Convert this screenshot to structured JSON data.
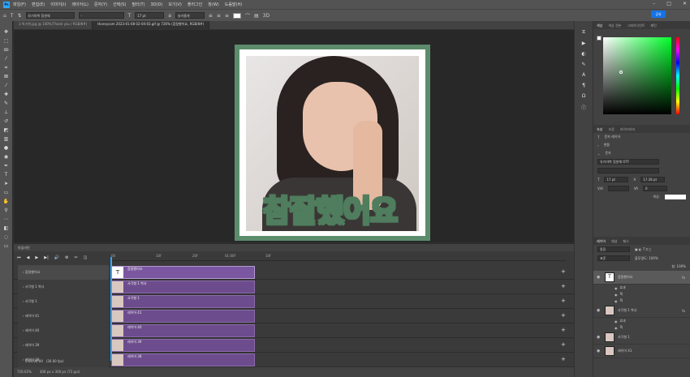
{
  "menu": {
    "logo": "Ps",
    "items": [
      "파일(F)",
      "편집(E)",
      "이미지(I)",
      "레이어(L)",
      "문자(Y)",
      "선택(S)",
      "필터(T)",
      "3D(D)",
      "보기(V)",
      "플러그인",
      "창(W)",
      "도움말(H)"
    ],
    "share": "공유"
  },
  "options": {
    "font_family": "유기야복 힘샌체",
    "font_style": "-",
    "font_size": "17 pt",
    "aa": "날카롭게"
  },
  "tabs": [
    {
      "label": "1-특가위.jpg @ 100%(Thank you / RGB/8#)"
    },
    {
      "label": "Honeycam 2023-01-08 02-04-03.gif @ 726% (참잘했어요, RGB/8#)"
    }
  ],
  "canvas": {
    "caption": "참잘했어요"
  },
  "timeline": {
    "title": "타임라인",
    "ruler": [
      "00",
      "10f",
      "20f",
      "01:00f",
      "10f"
    ],
    "time": "0:00:00:00",
    "fps": "(30.00 fps)",
    "tracks": [
      {
        "label": "참잘했어요",
        "clip": "참잘했어요",
        "text": true
      },
      {
        "label": "사각형 1 복사",
        "clip": "사각형 1 복사",
        "text": false
      },
      {
        "label": "사각형 1",
        "clip": "사각형 1",
        "text": false
      },
      {
        "label": "레이어 41",
        "clip": "레이어 41",
        "text": false
      },
      {
        "label": "레이어 40",
        "clip": "레이어 40",
        "text": false
      },
      {
        "label": "레이어 39",
        "clip": "레이어 39",
        "text": false
      },
      {
        "label": "레이어 38",
        "clip": "레이어 38",
        "text": false
      }
    ]
  },
  "status": {
    "zoom": "726.02%",
    "size": "300 px x 300 px (72 ppi)"
  },
  "color_panel": {
    "tabs": [
      "색상",
      "색상 견본",
      "그레이디언트",
      "패턴"
    ]
  },
  "props_panel": {
    "tabs": [
      "속성",
      "조정",
      "라이브러리"
    ],
    "type": "문자 레이어",
    "section_transform": "변환",
    "section_char": "문자",
    "font": "유기야복 힘샌체 OTF",
    "size": "17 pt",
    "leading": "17.28 pt",
    "tracking": "0",
    "color_label": "색상:"
  },
  "layers_panel": {
    "tabs": [
      "레이어",
      "채널",
      "패스"
    ],
    "filter": "종류",
    "blend": "표준",
    "opacity": "불투명도: 100%",
    "fill": "칠: 100%",
    "layers": [
      {
        "name": "참잘했어요",
        "type": "text",
        "fx": true,
        "sub": [
          "효과",
          "획",
          "획"
        ]
      },
      {
        "name": "사각형 1 복사",
        "type": "shape",
        "fx": true,
        "sub": [
          "효과",
          "획"
        ]
      },
      {
        "name": "사각형 1",
        "type": "shape",
        "fx": false,
        "sub": []
      },
      {
        "name": "레이어 41",
        "type": "image",
        "fx": false,
        "sub": []
      }
    ]
  }
}
